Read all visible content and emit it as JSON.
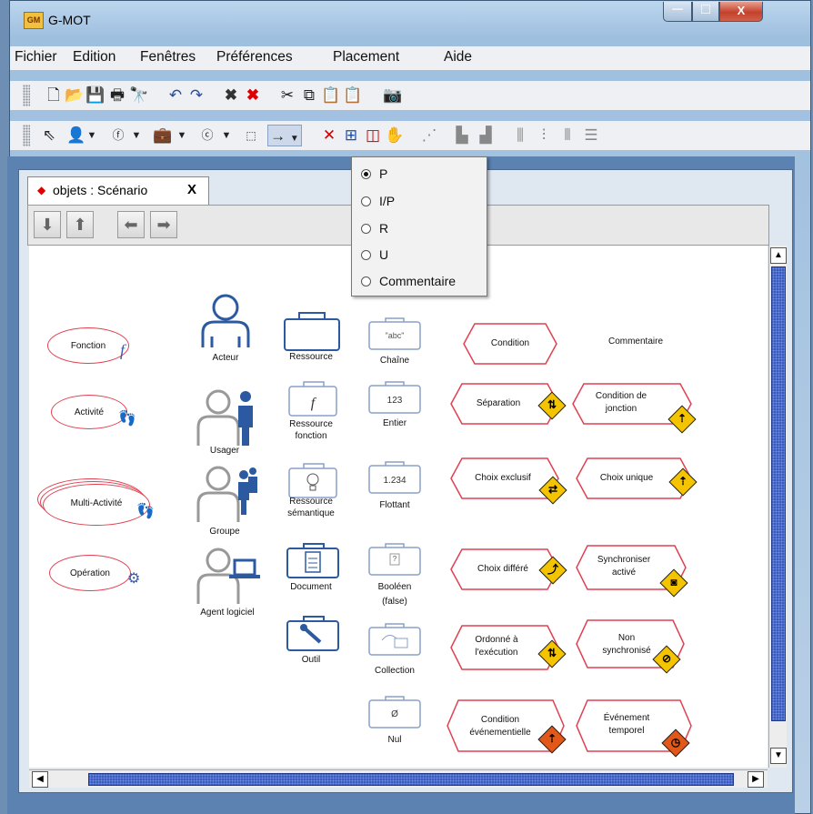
{
  "window": {
    "title": "G-MOT",
    "min": "─",
    "max": "□",
    "close": "X"
  },
  "menu": [
    "Fichier",
    "Edition",
    "Fenêtres",
    "Préférences",
    "Placement",
    "Aide"
  ],
  "toolbar1": [
    "new-icon",
    "open-icon",
    "save-icon",
    "print-icon",
    "find-icon",
    "undo-icon",
    "redo-icon",
    "delete-icon",
    "delete-red-icon",
    "cut-icon",
    "copy-icon",
    "paste-icon",
    "paste-special-icon",
    "camera-icon"
  ],
  "toolbar2": [
    "pointer-icon",
    "actor-icon",
    "function-icon",
    "resource-icon",
    "concept-icon",
    "text-icon",
    "link-icon",
    "zoom-icon",
    "fit-icon",
    "select-zone-icon",
    "hand-icon"
  ],
  "tab": {
    "label": "objets : Scénario",
    "close": "X"
  },
  "link_menu": {
    "options": [
      "P",
      "I/P",
      "R",
      "U",
      "Commentaire"
    ],
    "selected": "P"
  },
  "palette": {
    "ovals": {
      "fonction": "Fonction",
      "activite": "Activité",
      "multi": "Multi-Activité",
      "operation": "Opération"
    },
    "actors": {
      "acteur": "Acteur",
      "usager": "Usager",
      "groupe": "Groupe",
      "agent": "Agent logiciel"
    },
    "resources": {
      "ressource": "Ressource",
      "fonction1": "Ressource",
      "fonction2": "fonction",
      "semantique1": "Ressource",
      "semantique2": "sémantique",
      "document": "Document",
      "outil": "Outil"
    },
    "types": {
      "chaine_sample": "\"abc\"",
      "chaine": "Chaîne",
      "entier_sample": "123",
      "entier": "Entier",
      "flottant_sample": "1.234",
      "flottant": "Flottant",
      "booleen_sample": "?",
      "booleen1": "Booléen",
      "booleen2": "(false)",
      "collection": "Collection",
      "nul_sample": "Ø",
      "nul": "Nul"
    },
    "conditions": {
      "condition": "Condition",
      "commentaire": "Commentaire",
      "separation": "Séparation",
      "condition_jonction1": "Condition de",
      "condition_jonction2": "jonction",
      "choix_exclusif": "Choix exclusif",
      "choix_unique": "Choix unique",
      "choix_differe": "Choix différé",
      "synchroniser1": "Synchroniser",
      "synchroniser2": "activé",
      "ordonne1": "Ordonné à",
      "ordonne2": "l'exécution",
      "non_sync1": "Non",
      "non_sync2": "synchronisé",
      "cond_evt1": "Condition",
      "cond_evt2": "événementielle",
      "evt_temp1": "Événement",
      "evt_temp2": "temporel"
    }
  }
}
